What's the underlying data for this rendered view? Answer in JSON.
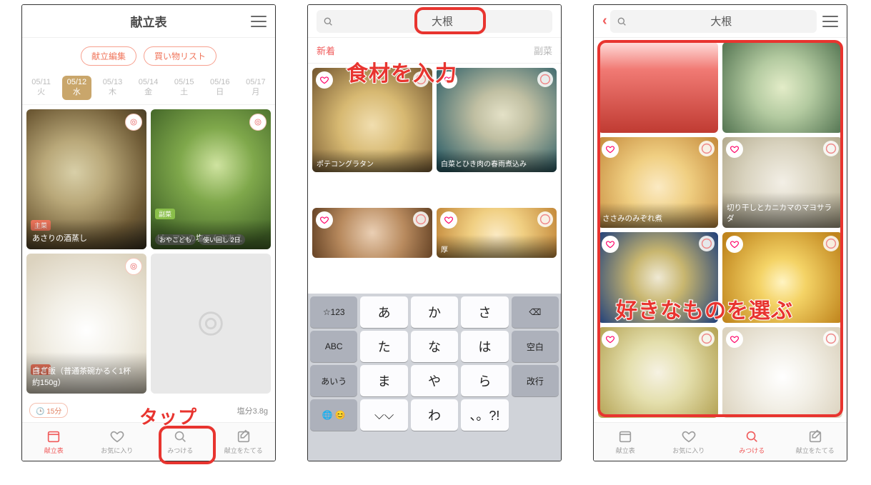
{
  "annotations": {
    "tap": "タップ",
    "enterIngredient": "食材を入力",
    "chooseFav": "好きなものを選ぶ"
  },
  "screen1": {
    "headerTitle": "献立表",
    "pills": {
      "edit": "献立編集",
      "shop": "買い物リスト"
    },
    "dates": [
      {
        "d": "05/11",
        "w": "火"
      },
      {
        "d": "05/12",
        "w": "水"
      },
      {
        "d": "05/13",
        "w": "木"
      },
      {
        "d": "05/14",
        "w": "金"
      },
      {
        "d": "05/15",
        "w": "土"
      },
      {
        "d": "05/16",
        "w": "日"
      },
      {
        "d": "05/17",
        "w": "月"
      }
    ],
    "cards": {
      "clam": {
        "badge": "主菜",
        "title": "あさりの酒蒸し"
      },
      "veg": {
        "badge": "副菜",
        "title": "ピーマンの塩こんぶあえ",
        "chip1": "おやこども",
        "chip2": "使い回し 2日"
      },
      "rice": {
        "badge": "主食",
        "title": "白ご飯（普通茶碗かるく1杯 約150g）"
      }
    },
    "nutri": {
      "time": "15分",
      "salt": "塩分3.8g"
    },
    "nav": {
      "kondate": "献立表",
      "fav": "お気に入り",
      "find": "みつける",
      "plan": "献立をたてる"
    }
  },
  "screen2": {
    "searchText": "大根",
    "tabs": {
      "new": "新着",
      "side": "副菜"
    },
    "cards": {
      "gratin": "ポテコングラタン",
      "harusame": "白菜とひき肉の春雨煮込み",
      "atsuage": "厚"
    },
    "keyboard": {
      "r1": [
        "☆123",
        "あ",
        "か",
        "さ",
        "⌫"
      ],
      "r2": [
        "ABC",
        "た",
        "な",
        "は",
        "空白"
      ],
      "r3": [
        "あいう",
        "ま",
        "や",
        "ら",
        "改行"
      ],
      "r4": [
        "🌐 😊",
        "⌵⌵",
        "わ",
        "、。?!"
      ]
    }
  },
  "screen3": {
    "searchText": "大根",
    "cards": {
      "c1": "ささみのみぞれ煮",
      "c2": "切り干しとカニカマのマヨサラダ"
    },
    "nav": {
      "kondate": "献立表",
      "fav": "お気に入り",
      "find": "みつける",
      "plan": "献立をたてる"
    }
  }
}
